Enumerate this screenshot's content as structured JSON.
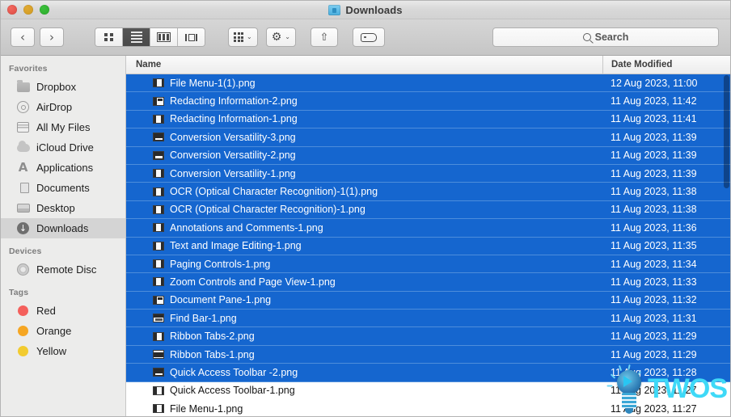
{
  "window": {
    "title": "Downloads",
    "traffic_lights": [
      "close",
      "minimize",
      "zoom"
    ]
  },
  "toolbar": {
    "back_label": "‹",
    "forward_label": "›",
    "view_modes": [
      {
        "name": "icon-view",
        "active": false
      },
      {
        "name": "list-view",
        "active": true
      },
      {
        "name": "column-view",
        "active": false
      },
      {
        "name": "coverflow-view",
        "active": false
      }
    ],
    "arrange_label": "",
    "action_label": "⚙",
    "share_label": "⇧",
    "tag_label": "",
    "caret": "⌄"
  },
  "search": {
    "placeholder": "Search"
  },
  "sidebar": {
    "sections": [
      {
        "title": "Favorites",
        "items": [
          {
            "label": "Dropbox",
            "icon": "folder-icon",
            "selected": false
          },
          {
            "label": "AirDrop",
            "icon": "airdrop-icon",
            "selected": false
          },
          {
            "label": "All My Files",
            "icon": "all-my-files-icon",
            "selected": false
          },
          {
            "label": "iCloud Drive",
            "icon": "icloud-icon",
            "selected": false
          },
          {
            "label": "Applications",
            "icon": "applications-icon",
            "selected": false
          },
          {
            "label": "Documents",
            "icon": "documents-icon",
            "selected": false
          },
          {
            "label": "Desktop",
            "icon": "desktop-icon",
            "selected": false
          },
          {
            "label": "Downloads",
            "icon": "downloads-icon",
            "selected": true
          }
        ]
      },
      {
        "title": "Devices",
        "items": [
          {
            "label": "Remote Disc",
            "icon": "disc-icon",
            "selected": false
          }
        ]
      },
      {
        "title": "Tags",
        "items": [
          {
            "label": "Red",
            "icon": "tag-dot-icon",
            "color": "#f4605c",
            "selected": false
          },
          {
            "label": "Orange",
            "icon": "tag-dot-icon",
            "color": "#f5a623",
            "selected": false
          },
          {
            "label": "Yellow",
            "icon": "tag-dot-icon",
            "color": "#f2cb30",
            "selected": false
          }
        ]
      }
    ]
  },
  "filelist": {
    "columns": [
      "Name",
      "Date Modified"
    ],
    "rows": [
      {
        "name": "File Menu-1(1).png",
        "date": "12 Aug 2023, 11:00",
        "selected": true,
        "thumb": "t-a"
      },
      {
        "name": "Redacting Information-2.png",
        "date": "11 Aug 2023, 11:42",
        "selected": true,
        "thumb": "t-d"
      },
      {
        "name": "Redacting Information-1.png",
        "date": "11 Aug 2023, 11:41",
        "selected": true,
        "thumb": "t-b"
      },
      {
        "name": "Conversion Versatility-3.png",
        "date": "11 Aug 2023, 11:39",
        "selected": true,
        "thumb": "t-c"
      },
      {
        "name": "Conversion Versatility-2.png",
        "date": "11 Aug 2023, 11:39",
        "selected": true,
        "thumb": "t-c"
      },
      {
        "name": "Conversion Versatility-1.png",
        "date": "11 Aug 2023, 11:39",
        "selected": true,
        "thumb": "t-b"
      },
      {
        "name": "OCR (Optical Character Recognition)-1(1).png",
        "date": "11 Aug 2023, 11:38",
        "selected": true,
        "thumb": "t-b"
      },
      {
        "name": "OCR (Optical Character Recognition)-1.png",
        "date": "11 Aug 2023, 11:38",
        "selected": true,
        "thumb": "t-b"
      },
      {
        "name": "Annotations and Comments-1.png",
        "date": "11 Aug 2023, 11:36",
        "selected": true,
        "thumb": "t-b"
      },
      {
        "name": "Text and Image Editing-1.png",
        "date": "11 Aug 2023, 11:35",
        "selected": true,
        "thumb": "t-b"
      },
      {
        "name": "Paging Controls-1.png",
        "date": "11 Aug 2023, 11:34",
        "selected": true,
        "thumb": "t-b"
      },
      {
        "name": "Zoom Controls and Page View-1.png",
        "date": "11 Aug 2023, 11:33",
        "selected": true,
        "thumb": "t-b"
      },
      {
        "name": "Document Pane-1.png",
        "date": "11 Aug 2023, 11:32",
        "selected": true,
        "thumb": "t-d"
      },
      {
        "name": "Find Bar-1.png",
        "date": "11 Aug 2023, 11:31",
        "selected": true,
        "thumb": "t-e"
      },
      {
        "name": "Ribbon Tabs-2.png",
        "date": "11 Aug 2023, 11:29",
        "selected": true,
        "thumb": "t-a"
      },
      {
        "name": "Ribbon Tabs-1.png",
        "date": "11 Aug 2023, 11:29",
        "selected": true,
        "thumb": "t-f"
      },
      {
        "name": "Quick Access Toolbar -2.png",
        "date": "11 Aug 2023, 11:28",
        "selected": true,
        "thumb": "t-c"
      },
      {
        "name": "Quick Access Toolbar-1.png",
        "date": "11 Aug 2023, 11:27",
        "selected": false,
        "thumb": "t-a"
      },
      {
        "name": "File Menu-1.png",
        "date": "11 Aug 2023, 11:27",
        "selected": false,
        "thumb": "t-a"
      }
    ]
  },
  "watermark": {
    "text": "TWOS",
    "color": "#3fd9f7"
  }
}
